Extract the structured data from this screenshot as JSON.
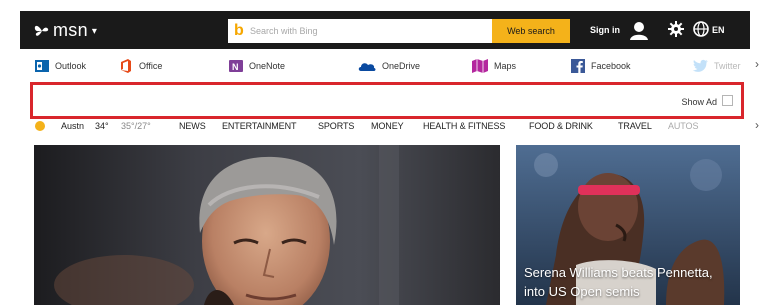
{
  "header": {
    "logo_text": "msn",
    "logo_icon": "butterfly-icon",
    "search": {
      "placeholder": "Search with Bing",
      "value": "",
      "button_label": "Web search",
      "icon": "bing-icon"
    },
    "sign_in_label": "Sign in",
    "user_icon": "user-icon",
    "settings_icon": "gear-icon",
    "globe_icon": "globe-icon",
    "language": "EN"
  },
  "apps": [
    {
      "label": "Outlook",
      "icon": "outlook-icon",
      "color": "#0a64ad"
    },
    {
      "label": "Office",
      "icon": "office-icon",
      "color": "#e64a19"
    },
    {
      "label": "OneNote",
      "icon": "onenote-icon",
      "color": "#7f3f98"
    },
    {
      "label": "OneDrive",
      "icon": "onedrive-icon",
      "color": "#0a4aa0"
    },
    {
      "label": "Maps",
      "icon": "maps-icon",
      "color": "#b4279e"
    },
    {
      "label": "Facebook",
      "icon": "facebook-icon",
      "color": "#3b5998"
    },
    {
      "label": "Twitter",
      "icon": "twitter-icon",
      "color": "#55acee"
    }
  ],
  "ad": {
    "show_ad_label": "Show Ad"
  },
  "nav": {
    "weather": {
      "city": "Austn",
      "temp": "34°",
      "range": "35°/27°",
      "icon": "sun-icon"
    },
    "items": [
      "NEWS",
      "ENTERTAINMENT",
      "SPORTS",
      "MONEY",
      "HEALTH & FITNESS",
      "FOOD & DRINK",
      "TRAVEL",
      "AUTOS"
    ]
  },
  "stories": {
    "side_caption": "Serena Williams beats Pennetta, into US Open semis"
  },
  "colors": {
    "topbar": "#1a1a1a",
    "search_button": "#f4b21a",
    "ad_border": "#d9262c"
  }
}
